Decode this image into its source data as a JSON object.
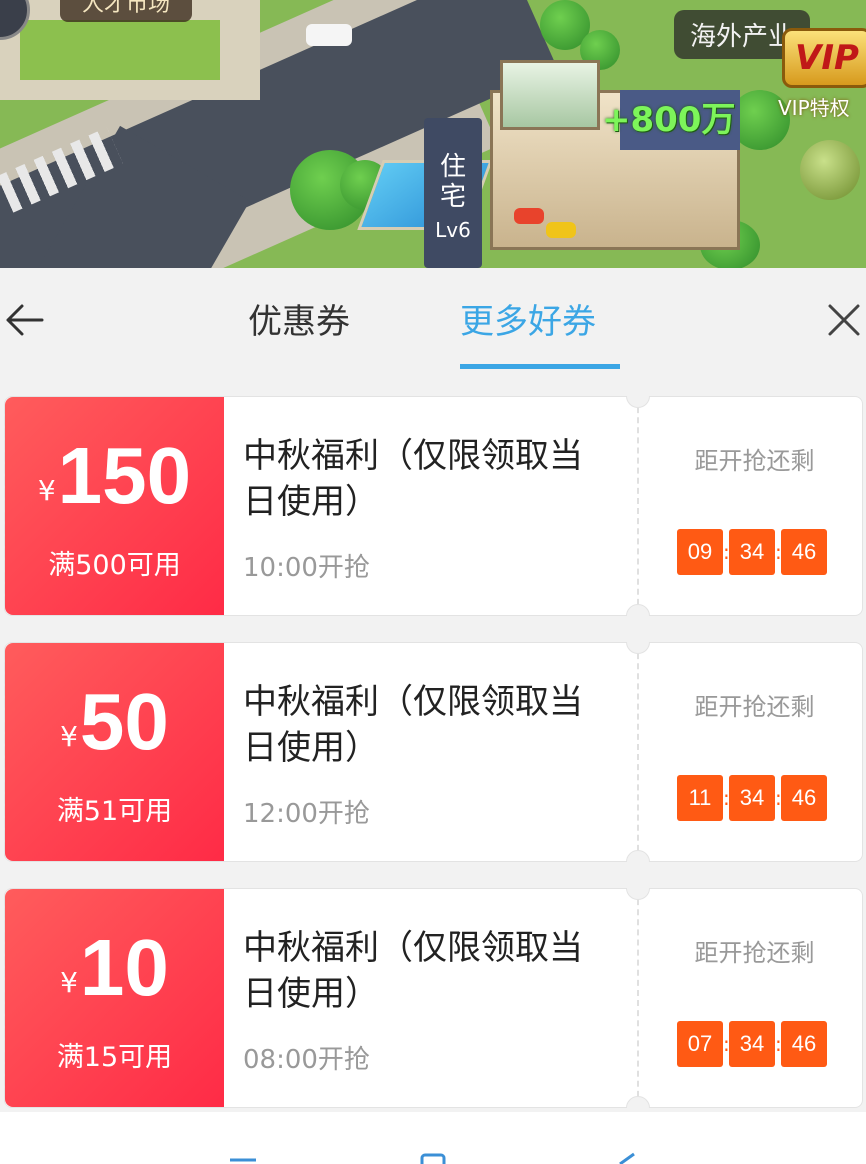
{
  "scene": {
    "label_top": "人才市场",
    "label_overseas": "海外产业",
    "vip_badge": "VIP",
    "vip_sub": "VIP特权",
    "income_bonus": "+800万",
    "house_tag_chars": [
      "住",
      "宅"
    ],
    "house_level": "Lv6"
  },
  "header": {
    "tabs": [
      {
        "label": "优惠券",
        "active": false
      },
      {
        "label": "更多好券",
        "active": true
      }
    ],
    "accent_color": "#3ba6e5"
  },
  "coupons": [
    {
      "currency": "¥",
      "amount": "150",
      "condition": "满500可用",
      "title": "中秋福利（仅限领取当日使用）",
      "start": "10:00开抢",
      "countdown_label": "距开抢还剩",
      "countdown": [
        "09",
        "34",
        "46"
      ]
    },
    {
      "currency": "¥",
      "amount": "50",
      "condition": "满51可用",
      "title": "中秋福利（仅限领取当日使用）",
      "start": "12:00开抢",
      "countdown_label": "距开抢还剩",
      "countdown": [
        "11",
        "34",
        "46"
      ]
    },
    {
      "currency": "¥",
      "amount": "10",
      "condition": "满15可用",
      "title": "中秋福利（仅限领取当日使用）",
      "start": "08:00开抢",
      "countdown_label": "距开抢还剩",
      "countdown": [
        "07",
        "34",
        "46"
      ]
    }
  ],
  "colors": {
    "coupon_stub": "#ff3b4f",
    "timer_box": "#ff5a14",
    "tab_active": "#3ba6e5"
  }
}
